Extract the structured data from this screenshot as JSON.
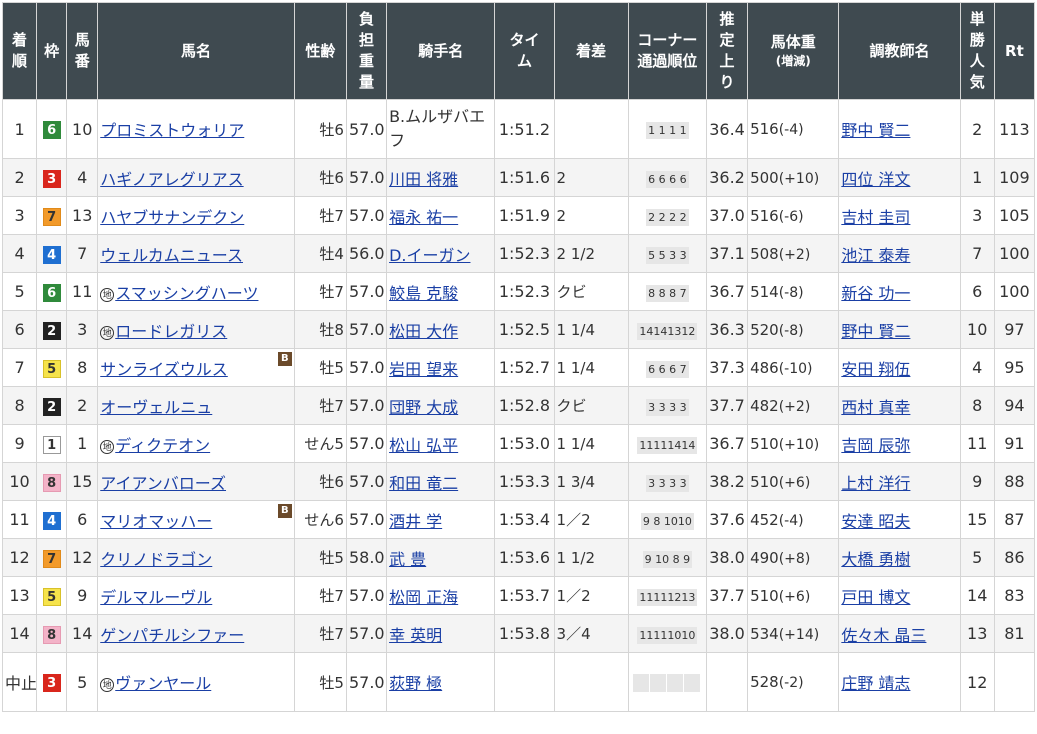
{
  "headers": {
    "rank": "着順",
    "waku": "枠",
    "umaban": "馬番",
    "horse": "馬名",
    "sexage": "性齢",
    "weight": "負担重量",
    "jockey": "騎手名",
    "time": "タイム",
    "margin": "着差",
    "corner": "コーナー通過順位",
    "last3f": "推定上り",
    "bodyweight": "馬体重",
    "bodyweight_sub": "(増減)",
    "trainer": "調教師名",
    "popularity": "単勝人気",
    "rating": "Rt"
  },
  "rows": [
    {
      "rank": "1",
      "waku": "6",
      "umaban": "10",
      "chi": "",
      "horse": "プロミストウォリア",
      "b": "",
      "sexage": "牡6",
      "weight": "57.0",
      "jockey": "B.ムルザバエフ",
      "time": "1:51.2",
      "margin": "",
      "corner": "1 1 1 1",
      "last3f": "36.4",
      "bw": "516",
      "bwc": "(-4)",
      "trainer": "野中 賢二",
      "pop": "2",
      "rt": "113"
    },
    {
      "rank": "2",
      "waku": "3",
      "umaban": "4",
      "chi": "",
      "horse": "ハギノアレグリアス",
      "b": "",
      "sexage": "牡6",
      "weight": "57.0",
      "jockey": "川田 将雅",
      "time": "1:51.6",
      "margin": "2",
      "corner": "6 6 6 6",
      "last3f": "36.2",
      "bw": "500",
      "bwc": "(+10)",
      "trainer": "四位 洋文",
      "pop": "1",
      "rt": "109"
    },
    {
      "rank": "3",
      "waku": "7",
      "umaban": "13",
      "chi": "",
      "horse": "ハヤブサナンデクン",
      "b": "",
      "sexage": "牡7",
      "weight": "57.0",
      "jockey": "福永 祐一",
      "time": "1:51.9",
      "margin": "2",
      "corner": "2 2 2 2",
      "last3f": "37.0",
      "bw": "516",
      "bwc": "(-6)",
      "trainer": "吉村 圭司",
      "pop": "3",
      "rt": "105"
    },
    {
      "rank": "4",
      "waku": "4",
      "umaban": "7",
      "chi": "",
      "horse": "ウェルカムニュース",
      "b": "",
      "sexage": "牡4",
      "weight": "56.0",
      "jockey": "D.イーガン",
      "time": "1:52.3",
      "margin": "2 1/2",
      "corner": "5 5 3 3",
      "last3f": "37.1",
      "bw": "508",
      "bwc": "(+2)",
      "trainer": "池江 泰寿",
      "pop": "7",
      "rt": "100"
    },
    {
      "rank": "5",
      "waku": "6",
      "umaban": "11",
      "chi": "地",
      "horse": "スマッシングハーツ",
      "b": "",
      "sexage": "牡7",
      "weight": "57.0",
      "jockey": "鮫島 克駿",
      "time": "1:52.3",
      "margin": "クビ",
      "corner": "8 8 8 7",
      "last3f": "36.7",
      "bw": "514",
      "bwc": "(-8)",
      "trainer": "新谷 功一",
      "pop": "6",
      "rt": "100"
    },
    {
      "rank": "6",
      "waku": "2",
      "umaban": "3",
      "chi": "地",
      "horse": "ロードレガリス",
      "b": "",
      "sexage": "牡8",
      "weight": "57.0",
      "jockey": "松田 大作",
      "time": "1:52.5",
      "margin": "1 1/4",
      "corner": "14141312",
      "last3f": "36.3",
      "bw": "520",
      "bwc": "(-8)",
      "trainer": "野中 賢二",
      "pop": "10",
      "rt": "97"
    },
    {
      "rank": "7",
      "waku": "5",
      "umaban": "8",
      "chi": "",
      "horse": "サンライズウルス",
      "b": "B",
      "sexage": "牡5",
      "weight": "57.0",
      "jockey": "岩田 望来",
      "time": "1:52.7",
      "margin": "1 1/4",
      "corner": "6 6 6 7",
      "last3f": "37.3",
      "bw": "486",
      "bwc": "(-10)",
      "trainer": "安田 翔伍",
      "pop": "4",
      "rt": "95"
    },
    {
      "rank": "8",
      "waku": "2",
      "umaban": "2",
      "chi": "",
      "horse": "オーヴェルニュ",
      "b": "",
      "sexage": "牡7",
      "weight": "57.0",
      "jockey": "団野 大成",
      "time": "1:52.8",
      "margin": "クビ",
      "corner": "3 3 3 3",
      "last3f": "37.7",
      "bw": "482",
      "bwc": "(+2)",
      "trainer": "西村 真幸",
      "pop": "8",
      "rt": "94"
    },
    {
      "rank": "9",
      "waku": "1",
      "umaban": "1",
      "chi": "地",
      "horse": "ディクテオン",
      "b": "",
      "sexage": "せん5",
      "weight": "57.0",
      "jockey": "松山 弘平",
      "time": "1:53.0",
      "margin": "1 1/4",
      "corner": "11111414",
      "last3f": "36.7",
      "bw": "510",
      "bwc": "(+10)",
      "trainer": "吉岡 辰弥",
      "pop": "11",
      "rt": "91"
    },
    {
      "rank": "10",
      "waku": "8",
      "umaban": "15",
      "chi": "",
      "horse": "アイアンバローズ",
      "b": "",
      "sexage": "牡6",
      "weight": "57.0",
      "jockey": "和田 竜二",
      "time": "1:53.3",
      "margin": "1 3/4",
      "corner": "3 3 3 3",
      "last3f": "38.2",
      "bw": "510",
      "bwc": "(+6)",
      "trainer": "上村 洋行",
      "pop": "9",
      "rt": "88"
    },
    {
      "rank": "11",
      "waku": "4",
      "umaban": "6",
      "chi": "",
      "horse": "マリオマッハー",
      "b": "B",
      "sexage": "せん6",
      "weight": "57.0",
      "jockey": "酒井 学",
      "time": "1:53.4",
      "margin": "1／2",
      "corner": "9 8 1010",
      "last3f": "37.6",
      "bw": "452",
      "bwc": "(-4)",
      "trainer": "安達 昭夫",
      "pop": "15",
      "rt": "87"
    },
    {
      "rank": "12",
      "waku": "7",
      "umaban": "12",
      "chi": "",
      "horse": "クリノドラゴン",
      "b": "",
      "sexage": "牡5",
      "weight": "58.0",
      "jockey": "武 豊",
      "time": "1:53.6",
      "margin": "1 1/2",
      "corner": "9 10 8 9",
      "last3f": "38.0",
      "bw": "490",
      "bwc": "(+8)",
      "trainer": "大橋 勇樹",
      "pop": "5",
      "rt": "86"
    },
    {
      "rank": "13",
      "waku": "5",
      "umaban": "9",
      "chi": "",
      "horse": "デルマルーヴル",
      "b": "",
      "sexage": "牡7",
      "weight": "57.0",
      "jockey": "松岡 正海",
      "time": "1:53.7",
      "margin": "1／2",
      "corner": "11111213",
      "last3f": "37.7",
      "bw": "510",
      "bwc": "(+6)",
      "trainer": "戸田 博文",
      "pop": "14",
      "rt": "83"
    },
    {
      "rank": "14",
      "waku": "8",
      "umaban": "14",
      "chi": "",
      "horse": "ゲンパチルシファー",
      "b": "",
      "sexage": "牡7",
      "weight": "57.0",
      "jockey": "幸 英明",
      "time": "1:53.8",
      "margin": "3／4",
      "corner": "11111010",
      "last3f": "38.0",
      "bw": "534",
      "bwc": "(+14)",
      "trainer": "佐々木 晶三",
      "pop": "13",
      "rt": "81"
    },
    {
      "rank": "中止",
      "waku": "3",
      "umaban": "5",
      "chi": "地",
      "horse": "ヴァンヤール",
      "b": "",
      "sexage": "牡5",
      "weight": "57.0",
      "jockey": "荻野 極",
      "time": "",
      "margin": "",
      "corner": "",
      "last3f": "",
      "bw": "528",
      "bwc": "(-2)",
      "trainer": "庄野 靖志",
      "pop": "12",
      "rt": ""
    }
  ]
}
